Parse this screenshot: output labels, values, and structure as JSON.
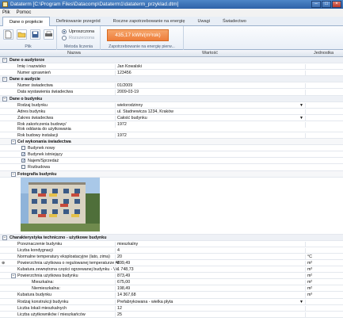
{
  "window": {
    "title": "Dataterm [C:\\Program Files\\Datacomp\\Dataterm1\\dataterm_przyklad.dtm]"
  },
  "menu": {
    "items": [
      "Plik",
      "Pomoc"
    ]
  },
  "tabs": [
    "Dane o projekcie",
    "Definiowanie przegród",
    "Roczne zapotrzebowanie na energię",
    "Uwagi",
    "Świadectwo"
  ],
  "ribbon": {
    "plik_caption": "Plik",
    "metoda_caption": "Metoda liczenia",
    "metoda_opt1": "Uproszczona",
    "metoda_opt2": "Rozszerzona",
    "energy_value": "435,17 kWh/(m²rok)",
    "energy_caption": "Zapotrzebowanie na energię pierw..."
  },
  "grid": {
    "col_name": "Nazwa",
    "col_value": "Wartość",
    "col_unit": "Jednostka",
    "s1": "Dane o audytorze",
    "imie_l": "Imię i nazwisko",
    "imie_v": "Jan Kowalski",
    "nr_upr_l": "Numer uprawnień",
    "nr_upr_v": "123456",
    "s2": "Dane o audycie",
    "nr_sw_l": "Numer świadectwa",
    "nr_sw_v": "01/2009",
    "data_l": "Data wystawienia świadectwa",
    "data_v": "2009-03-19",
    "s3": "Dane o budynku",
    "rodzaj_l": "Rodzaj budynku",
    "rodzaj_v": "wielorodzinny",
    "adres_l": "Adres budynku",
    "adres_v": "ul. Stadnewicza 1234, Kraków",
    "zakres_l": "Zakres świadectwa",
    "zakres_v": "Całość budynku",
    "rok_zak_l": "Rok zakończenia budowy/",
    "rok_zak_l2": "Rok oddania do użytkowania",
    "rok_zak_v": "1972",
    "rok_inst_l": "Rok budowy instalacji",
    "rok_inst_v": "1972",
    "s4": "Cel wykonania świadectwa",
    "cel1": "Budynek nowy",
    "cel2": "Budynek istniejący",
    "cel3": "Najem/Sprzedaż",
    "cel4": "Rozbudowa",
    "s5": "Fotografia budynku",
    "s6": "Charakterystyka techniczno - użytkowe budynku",
    "przezn_l": "Przeznaczenie budynku",
    "przezn_v": "mieszkalny",
    "kond_l": "Liczba kondygnacji",
    "kond_v": "4",
    "temp_l": "Normalne temperatury eksploatacyjne (lato, zima)",
    "temp_v": "20",
    "temp_u": "°C",
    "pow_reg_l": "Powierzchnia użytkowa o regulowanej temperaturze Af",
    "pow_reg_v": "699,49",
    "pow_reg_u": "m²",
    "kub_l": "Kubatura zewnętrzna części ogrzewanej budynku - Ve",
    "kub_v": "1 748,73",
    "kub_u": "m³",
    "pow_uz_l": "Powierzchnia użytkowa budynku",
    "pow_uz_v": "873,49",
    "pow_uz_u": "m²",
    "mieszk_l": "Mieszkalna:",
    "mieszk_v": "675,00",
    "mieszk_u": "m²",
    "niemieszk_l": "Niemieszkalna:",
    "niemieszk_v": "198,49",
    "niemieszk_u": "m²",
    "kubb_l": "Kubatura budynku",
    "kubb_v": "14 367,68",
    "kubb_u": "m³",
    "konstr_l": "Rodzaj konstrukcji budynku",
    "konstr_v": "Prefabrykowana - wielka płyta",
    "lokale_l": "Liczba lokali mieszkalnych",
    "lokale_v": "12",
    "uzytk_l": "Liczba użytkowników / mieszkańców",
    "uzytk_v": "25"
  },
  "colors": {
    "accent": "#ee7d3a",
    "titlebar": "#2e62a8",
    "section": "#eef1f6"
  }
}
